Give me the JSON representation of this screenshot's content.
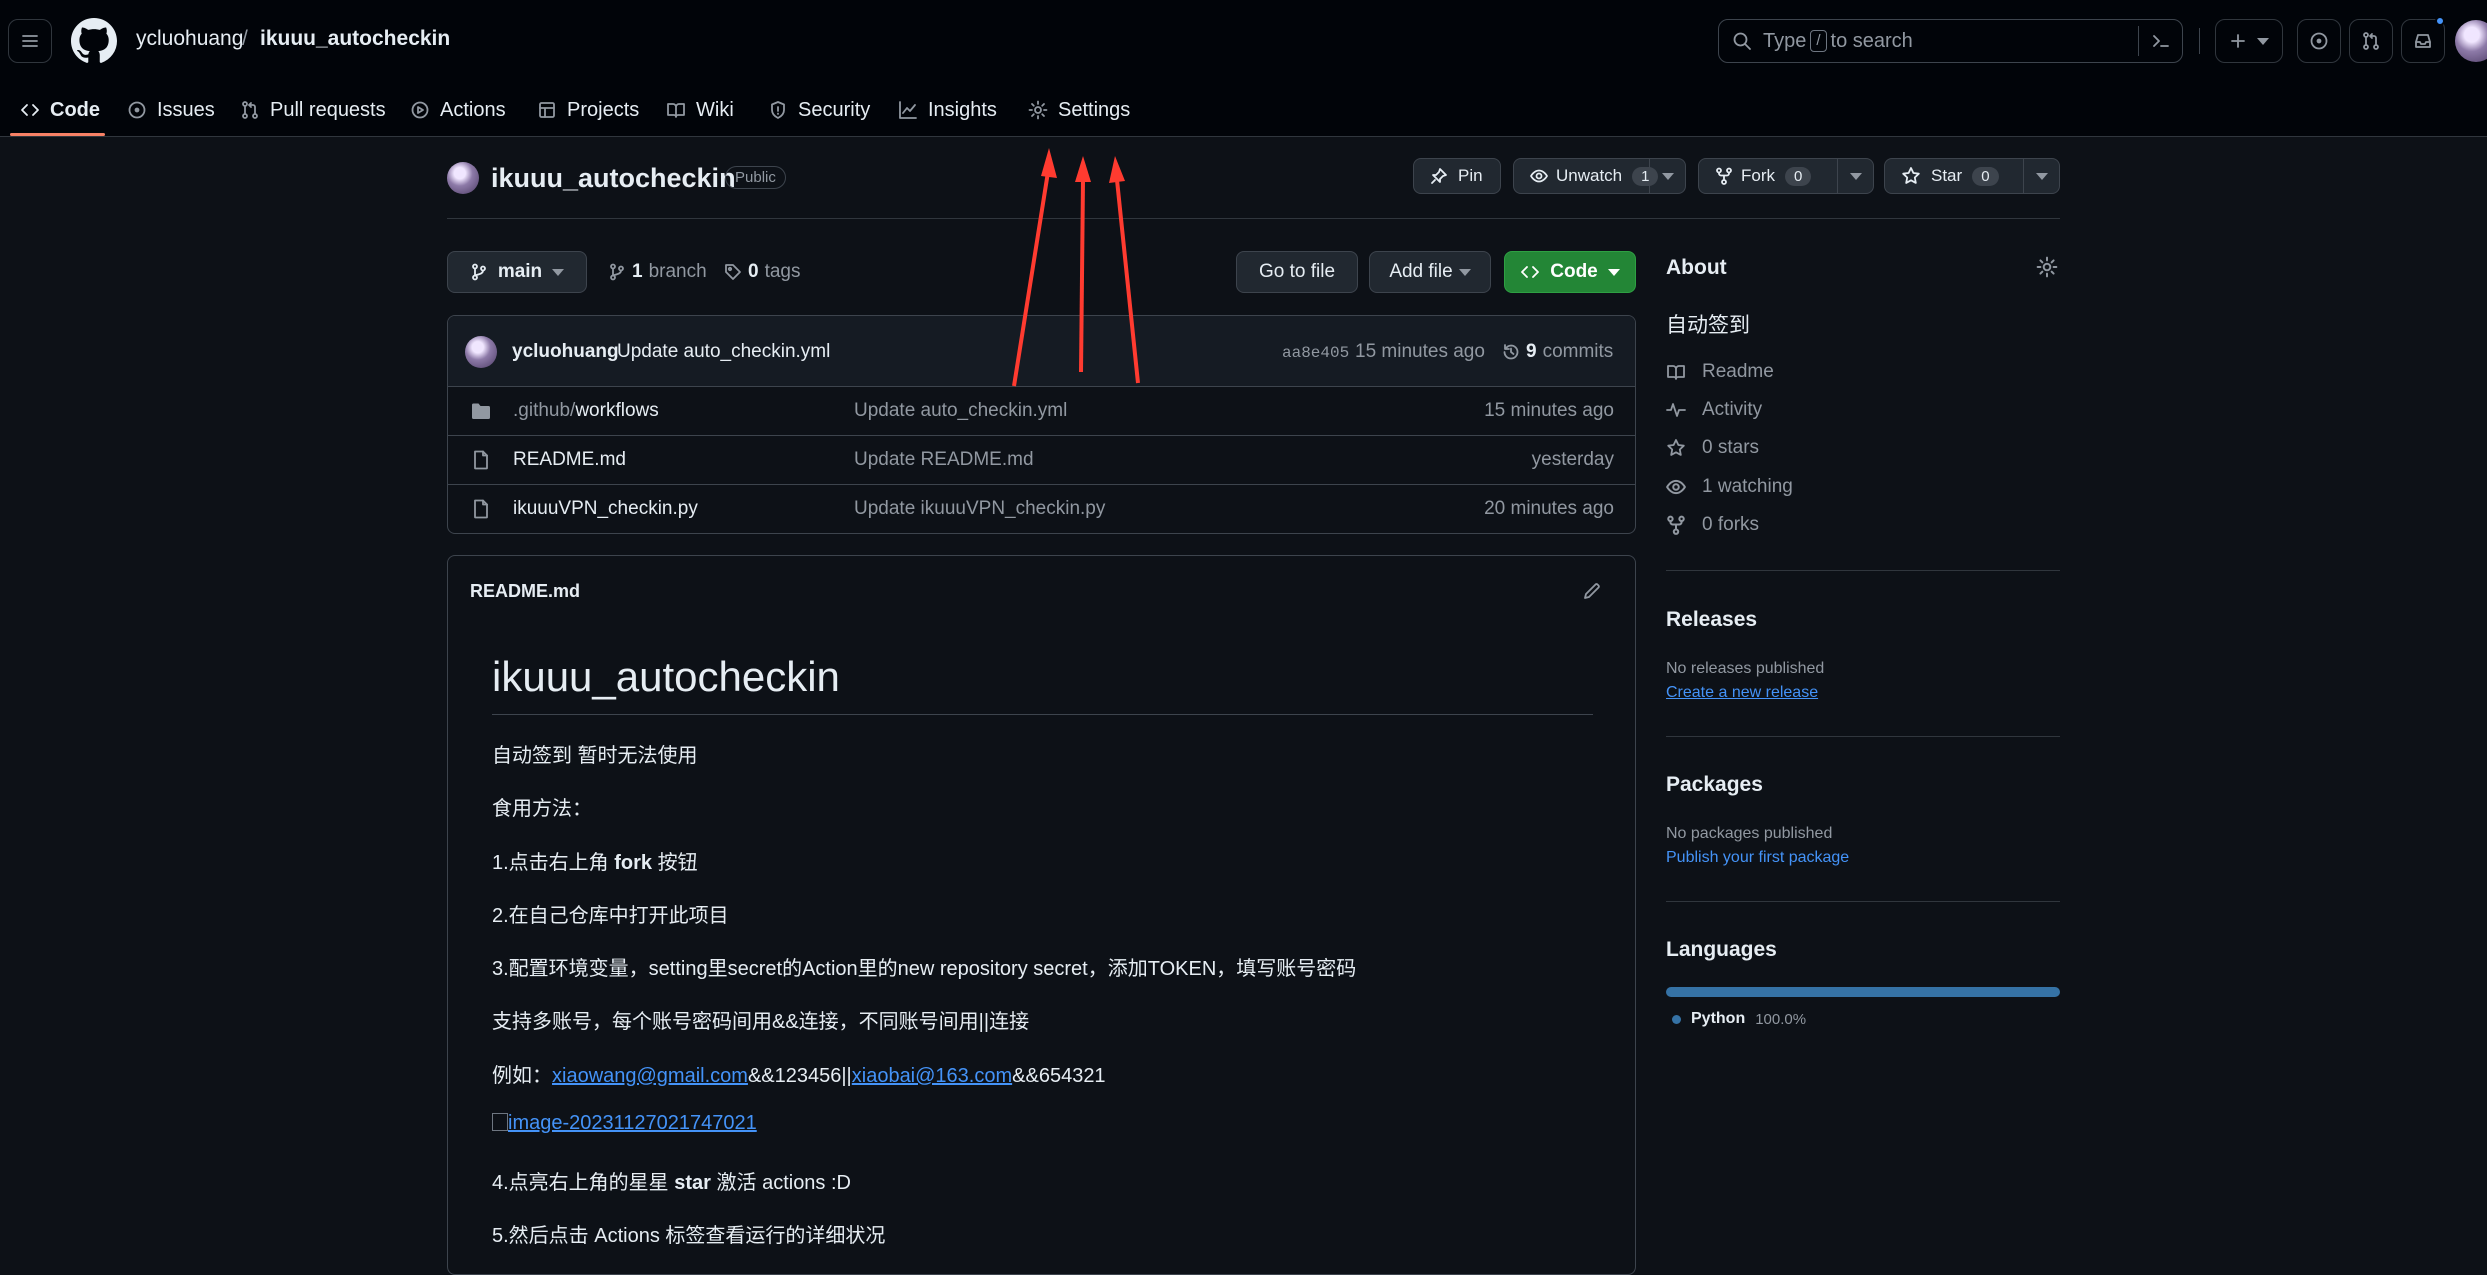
{
  "header": {
    "owner": "ycluohuang",
    "separator": "/",
    "repo": "ikuuu_autocheckin",
    "search_prefix": "Type",
    "search_key": "/",
    "search_suffix": "to search"
  },
  "tabs": [
    {
      "label": "Code"
    },
    {
      "label": "Issues"
    },
    {
      "label": "Pull requests"
    },
    {
      "label": "Actions"
    },
    {
      "label": "Projects"
    },
    {
      "label": "Wiki"
    },
    {
      "label": "Security"
    },
    {
      "label": "Insights"
    },
    {
      "label": "Settings"
    }
  ],
  "repo": {
    "name": "ikuuu_autocheckin",
    "visibility": "Public",
    "pin": "Pin",
    "unwatch": "Unwatch",
    "watch_count": "1",
    "fork": "Fork",
    "fork_count": "0",
    "star": "Star",
    "star_count": "0"
  },
  "toolbar": {
    "branch": "main",
    "branch_count": "1",
    "branch_label": "branch",
    "tag_count": "0",
    "tag_label": "tags",
    "go_to_file": "Go to file",
    "add_file": "Add file",
    "code": "Code"
  },
  "latest_commit": {
    "author": "ycluohuang",
    "message": "Update auto_checkin.yml",
    "sha": "aa8e405",
    "time": "15 minutes ago",
    "commit_count": "9",
    "commit_label": "commits"
  },
  "files": [
    {
      "prefix": ".github/",
      "name": "workflows",
      "message": "Update auto_checkin.yml",
      "time": "15 minutes ago",
      "type": "dir"
    },
    {
      "prefix": "",
      "name": "README.md",
      "message": "Update README.md",
      "time": "yesterday",
      "type": "file"
    },
    {
      "prefix": "",
      "name": "ikuuuVPN_checkin.py",
      "message": "Update ikuuuVPN_checkin.py",
      "time": "20 minutes ago",
      "type": "file"
    }
  ],
  "readme": {
    "filename": "README.md",
    "title": "ikuuu_autocheckin",
    "line1": "自动签到 暂时无法使用",
    "line2": "食用方法：",
    "step1_a": "1.点击右上角 ",
    "step1_b": "fork",
    "step1_c": " 按钮",
    "step2": "2.在自己仓库中打开此项目",
    "step3": "3.配置环境变量，setting里secret的Action里的new repository secret，添加TOKEN，填写账号密码",
    "multi": "支持多账号，每个账号密码间用&&连接，不同账号间用||连接",
    "example_label": "例如：",
    "example_email1": "xiaowang@gmail.com",
    "example_mid": "&&123456||",
    "example_email2": "xiaobai@163.com",
    "example_end": "&&654321",
    "image_alt": "image-20231127021747021",
    "step4_a": "4.点亮右上角的星星 ",
    "step4_b": "star",
    "step4_c": " 激活 actions :D",
    "step5": "5.然后点击 Actions 标签查看运行的详细状况"
  },
  "sidebar": {
    "about_title": "About",
    "description": "自动签到",
    "readme": "Readme",
    "activity": "Activity",
    "stars": "0 stars",
    "watching": "1 watching",
    "forks": "0 forks",
    "releases_title": "Releases",
    "releases_none": "No releases published",
    "releases_create": "Create a new release",
    "packages_title": "Packages",
    "packages_none": "No packages published",
    "packages_publish": "Publish your first package",
    "languages_title": "Languages",
    "language_name": "Python",
    "language_pct": "100.0%",
    "language_fraction": 1.0
  },
  "colors": {
    "accent_underline": "#f78166",
    "code_button": "#238636",
    "annotation_arrow": "#ff3b30",
    "language_bar": "#3572A5",
    "link": "#4493f8"
  }
}
